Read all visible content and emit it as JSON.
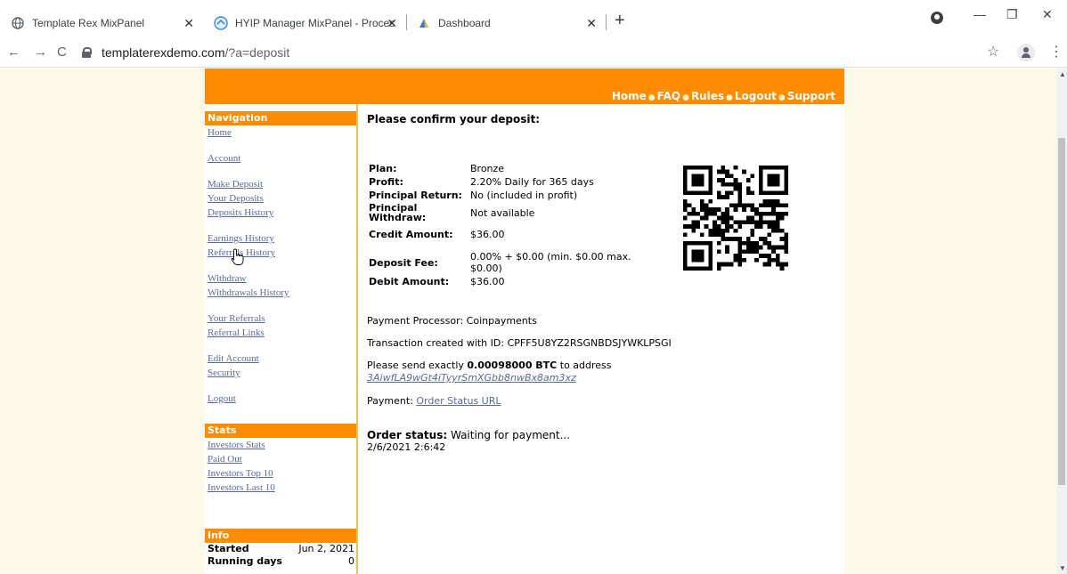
{
  "browser": {
    "tabs": [
      {
        "title": "Template Rex MixPanel",
        "icon": "globe-icon"
      },
      {
        "title": "HYIP Manager MixPanel - Proces",
        "icon": "hyip-logo-icon"
      },
      {
        "title": "Dashboard",
        "icon": "dashboard-favicon"
      }
    ],
    "url_host": "templaterexdemo.com",
    "url_rest": "/?a=deposit"
  },
  "site": {
    "accent_color": "#ff8c00",
    "top_nav": [
      "Home",
      "FAQ",
      "Rules",
      "Logout",
      "Support"
    ],
    "navigation": {
      "heading": "Navigation",
      "groups": [
        [
          "Home"
        ],
        [
          "Account"
        ],
        [
          "Make Deposit",
          "Your Deposits",
          "Deposits History"
        ],
        [
          "Earnings History",
          "Referrals History"
        ],
        [
          "Withdraw",
          "Withdrawals History"
        ],
        [
          "Your Referrals",
          "Referral Links"
        ],
        [
          "Edit Account",
          "Security"
        ],
        [
          "Logout"
        ]
      ]
    },
    "stats": {
      "heading": "Stats",
      "links": [
        "Investors Stats",
        "Paid Out",
        "Investors Top 10",
        "Investors Last 10"
      ]
    },
    "info": {
      "heading": "Info",
      "rows": [
        {
          "label": "Started",
          "value": "Jun 2, 2021"
        },
        {
          "label": "Running days",
          "value": "0"
        }
      ]
    }
  },
  "deposit": {
    "heading": "Please confirm your deposit:",
    "rows": [
      {
        "label": "Plan:",
        "value": "Bronze"
      },
      {
        "label": "Profit:",
        "value": "2.20% Daily for 365 days"
      },
      {
        "label": "Principal Return:",
        "value": "No (included in profit)"
      },
      {
        "label": "Principal Withdraw:",
        "value": "Not available"
      },
      {
        "label": "Credit Amount:",
        "value": "$36.00"
      },
      {
        "label": "Deposit Fee:",
        "value": "0.00% + $0.00 (min. $0.00 max. $0.00)"
      },
      {
        "label": "Debit Amount:",
        "value": "$36.00"
      }
    ],
    "processor_label": "Payment Processor:",
    "processor": "Coinpayments",
    "transaction_text": "Transaction created with ID:",
    "transaction_id": "CPFF5U8YZ2RSGNBDSJYWKLPSGI",
    "send_prefix": "Please send exactly",
    "send_amount": "0.00098000 BTC",
    "send_suffix": "to address",
    "address": "3AiwfLA9wGt4iTyyrSmXGbb8nwBx8am3xz",
    "payment_label": "Payment:",
    "payment_link": "Order Status URL",
    "status_label": "Order status:",
    "status_value": "Waiting for payment...",
    "status_time": "2/6/2021 2:6:42"
  }
}
